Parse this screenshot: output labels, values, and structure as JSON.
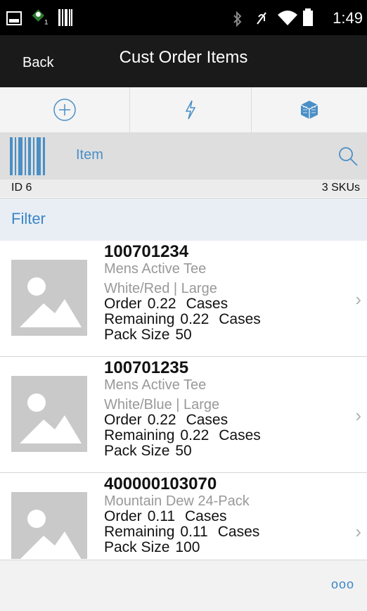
{
  "status_bar": {
    "time": "1:49",
    "icons": [
      "notification-image-icon",
      "android-user-icon",
      "barcode-status-icon",
      "bluetooth-icon",
      "mute-icon",
      "wifi-icon",
      "battery-icon"
    ]
  },
  "header": {
    "back_label": "Back",
    "title": "Cust Order Items"
  },
  "action_bar": {
    "icons": [
      "add-icon",
      "lightning-icon",
      "package-icon"
    ],
    "accent": "#4a8fc6"
  },
  "scan": {
    "label": "Item",
    "icons": [
      "barcode-icon",
      "search-icon"
    ]
  },
  "summary": {
    "id_label": "ID 6",
    "sku_count": "3 SKUs"
  },
  "filter": {
    "label": "Filter"
  },
  "items": [
    {
      "sku": "100701234",
      "desc1": "Mens Active Tee",
      "desc2": "White/Red | Large",
      "order_label": "Order",
      "order_value": "0.22",
      "order_unit": "Cases",
      "remaining_label": "Remaining",
      "remaining_value": "0.22",
      "remaining_unit": "Cases",
      "pack_label": "Pack Size",
      "pack_value": "50"
    },
    {
      "sku": "100701235",
      "desc1": "Mens Active Tee",
      "desc2": "White/Blue | Large",
      "order_label": "Order",
      "order_value": "0.22",
      "order_unit": "Cases",
      "remaining_label": "Remaining",
      "remaining_value": "0.22",
      "remaining_unit": "Cases",
      "pack_label": "Pack Size",
      "pack_value": "50"
    },
    {
      "sku": "400000103070",
      "desc1": "Mountain Dew 24-Pack",
      "order_label": "Order",
      "order_value": "0.11",
      "order_unit": "Cases",
      "remaining_label": "Remaining",
      "remaining_value": "0.11",
      "remaining_unit": "Cases",
      "pack_label": "Pack Size",
      "pack_value": "100"
    }
  ],
  "footer": {
    "more_label": "ooo"
  }
}
